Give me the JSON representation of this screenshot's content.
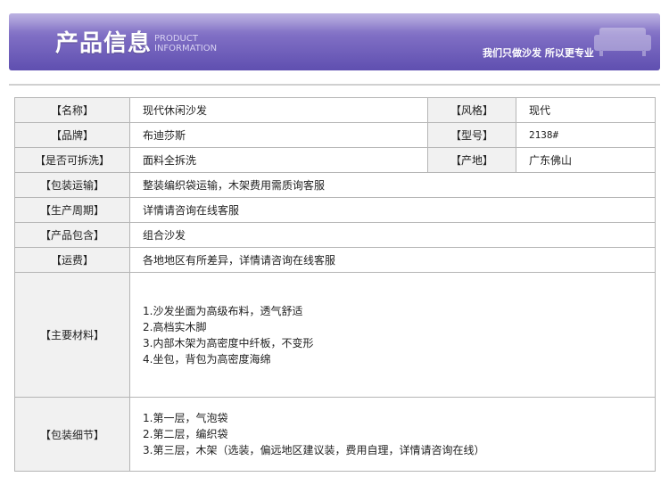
{
  "header": {
    "title_zh": "产品信息",
    "title_en_line1": "PRODUCT",
    "title_en_line2": "INFORMATION",
    "slogan": "我们只做沙发 所以更专业",
    "decoration_icon": "sofa-icon"
  },
  "colors": {
    "banner_top": "#a699d8",
    "banner_bottom": "#5f4fb0",
    "label_bg": "#f1f1f1",
    "border": "#b5b5b5"
  },
  "table": {
    "name": {
      "label": "【名称】",
      "value": "现代休闲沙发"
    },
    "style": {
      "label": "【风格】",
      "value": "现代"
    },
    "brand": {
      "label": "【品牌】",
      "value": "布迪莎斯"
    },
    "model": {
      "label": "【型号】",
      "value": "2138#"
    },
    "washable": {
      "label": "【是否可拆洗】",
      "value": "面料全拆洗"
    },
    "origin": {
      "label": "【产地】",
      "value": "广东佛山"
    },
    "packing_transport": {
      "label": "【包装运输】",
      "value": "整装编织袋运输，木架费用需质询客服"
    },
    "production_cycle": {
      "label": "【生产周期】",
      "value": "详情请咨询在线客服"
    },
    "includes": {
      "label": "【产品包含】",
      "value": "组合沙发"
    },
    "shipping": {
      "label": "【运费】",
      "value": "各地地区有所差异，详情请咨询在线客服"
    },
    "materials": {
      "label": "【主要材料】",
      "items": [
        "1.沙发坐面为高级布料，透气舒适",
        "2.高档实木脚",
        "3.内部木架为高密度中纤板，不变形",
        "4.坐包，背包为高密度海绵"
      ]
    },
    "packing_details": {
      "label": "【包装细节】",
      "items": [
        "1.第一层，气泡袋",
        "2.第二层，编织袋",
        "3.第三层，木架（选装，偏远地区建议装，费用自理，详情请咨询在线）"
      ]
    }
  }
}
